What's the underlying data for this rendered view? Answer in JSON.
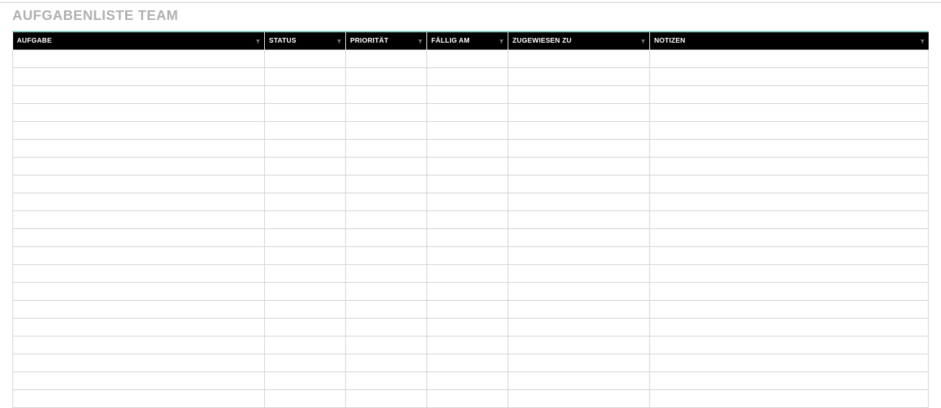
{
  "title": "AUFGABENLISTE TEAM",
  "columns": [
    {
      "key": "aufgabe",
      "label": "AUFGABE",
      "class": "col-aufgabe"
    },
    {
      "key": "status",
      "label": "STATUS",
      "class": "col-status"
    },
    {
      "key": "prioritaet",
      "label": "PRIORITÄT",
      "class": "col-prioritaet"
    },
    {
      "key": "faellig_am",
      "label": "FÄLLIG AM",
      "class": "col-faellig"
    },
    {
      "key": "zugewiesen_zu",
      "label": "ZUGEWIESEN ZU",
      "class": "col-zugewiesen"
    },
    {
      "key": "notizen",
      "label": "NOTIZEN",
      "class": "col-notizen"
    }
  ],
  "rows": [
    {
      "aufgabe": "",
      "status": "",
      "prioritaet": "",
      "faellig_am": "",
      "zugewiesen_zu": "",
      "notizen": ""
    },
    {
      "aufgabe": "",
      "status": "",
      "prioritaet": "",
      "faellig_am": "",
      "zugewiesen_zu": "",
      "notizen": ""
    },
    {
      "aufgabe": "",
      "status": "",
      "prioritaet": "",
      "faellig_am": "",
      "zugewiesen_zu": "",
      "notizen": ""
    },
    {
      "aufgabe": "",
      "status": "",
      "prioritaet": "",
      "faellig_am": "",
      "zugewiesen_zu": "",
      "notizen": ""
    },
    {
      "aufgabe": "",
      "status": "",
      "prioritaet": "",
      "faellig_am": "",
      "zugewiesen_zu": "",
      "notizen": ""
    },
    {
      "aufgabe": "",
      "status": "",
      "prioritaet": "",
      "faellig_am": "",
      "zugewiesen_zu": "",
      "notizen": ""
    },
    {
      "aufgabe": "",
      "status": "",
      "prioritaet": "",
      "faellig_am": "",
      "zugewiesen_zu": "",
      "notizen": ""
    },
    {
      "aufgabe": "",
      "status": "",
      "prioritaet": "",
      "faellig_am": "",
      "zugewiesen_zu": "",
      "notizen": ""
    },
    {
      "aufgabe": "",
      "status": "",
      "prioritaet": "",
      "faellig_am": "",
      "zugewiesen_zu": "",
      "notizen": ""
    },
    {
      "aufgabe": "",
      "status": "",
      "prioritaet": "",
      "faellig_am": "",
      "zugewiesen_zu": "",
      "notizen": ""
    },
    {
      "aufgabe": "",
      "status": "",
      "prioritaet": "",
      "faellig_am": "",
      "zugewiesen_zu": "",
      "notizen": ""
    },
    {
      "aufgabe": "",
      "status": "",
      "prioritaet": "",
      "faellig_am": "",
      "zugewiesen_zu": "",
      "notizen": ""
    },
    {
      "aufgabe": "",
      "status": "",
      "prioritaet": "",
      "faellig_am": "",
      "zugewiesen_zu": "",
      "notizen": ""
    },
    {
      "aufgabe": "",
      "status": "",
      "prioritaet": "",
      "faellig_am": "",
      "zugewiesen_zu": "",
      "notizen": ""
    },
    {
      "aufgabe": "",
      "status": "",
      "prioritaet": "",
      "faellig_am": "",
      "zugewiesen_zu": "",
      "notizen": ""
    },
    {
      "aufgabe": "",
      "status": "",
      "prioritaet": "",
      "faellig_am": "",
      "zugewiesen_zu": "",
      "notizen": ""
    },
    {
      "aufgabe": "",
      "status": "",
      "prioritaet": "",
      "faellig_am": "",
      "zugewiesen_zu": "",
      "notizen": ""
    },
    {
      "aufgabe": "",
      "status": "",
      "prioritaet": "",
      "faellig_am": "",
      "zugewiesen_zu": "",
      "notizen": ""
    },
    {
      "aufgabe": "",
      "status": "",
      "prioritaet": "",
      "faellig_am": "",
      "zugewiesen_zu": "",
      "notizen": ""
    },
    {
      "aufgabe": "",
      "status": "",
      "prioritaet": "",
      "faellig_am": "",
      "zugewiesen_zu": "",
      "notizen": ""
    }
  ]
}
